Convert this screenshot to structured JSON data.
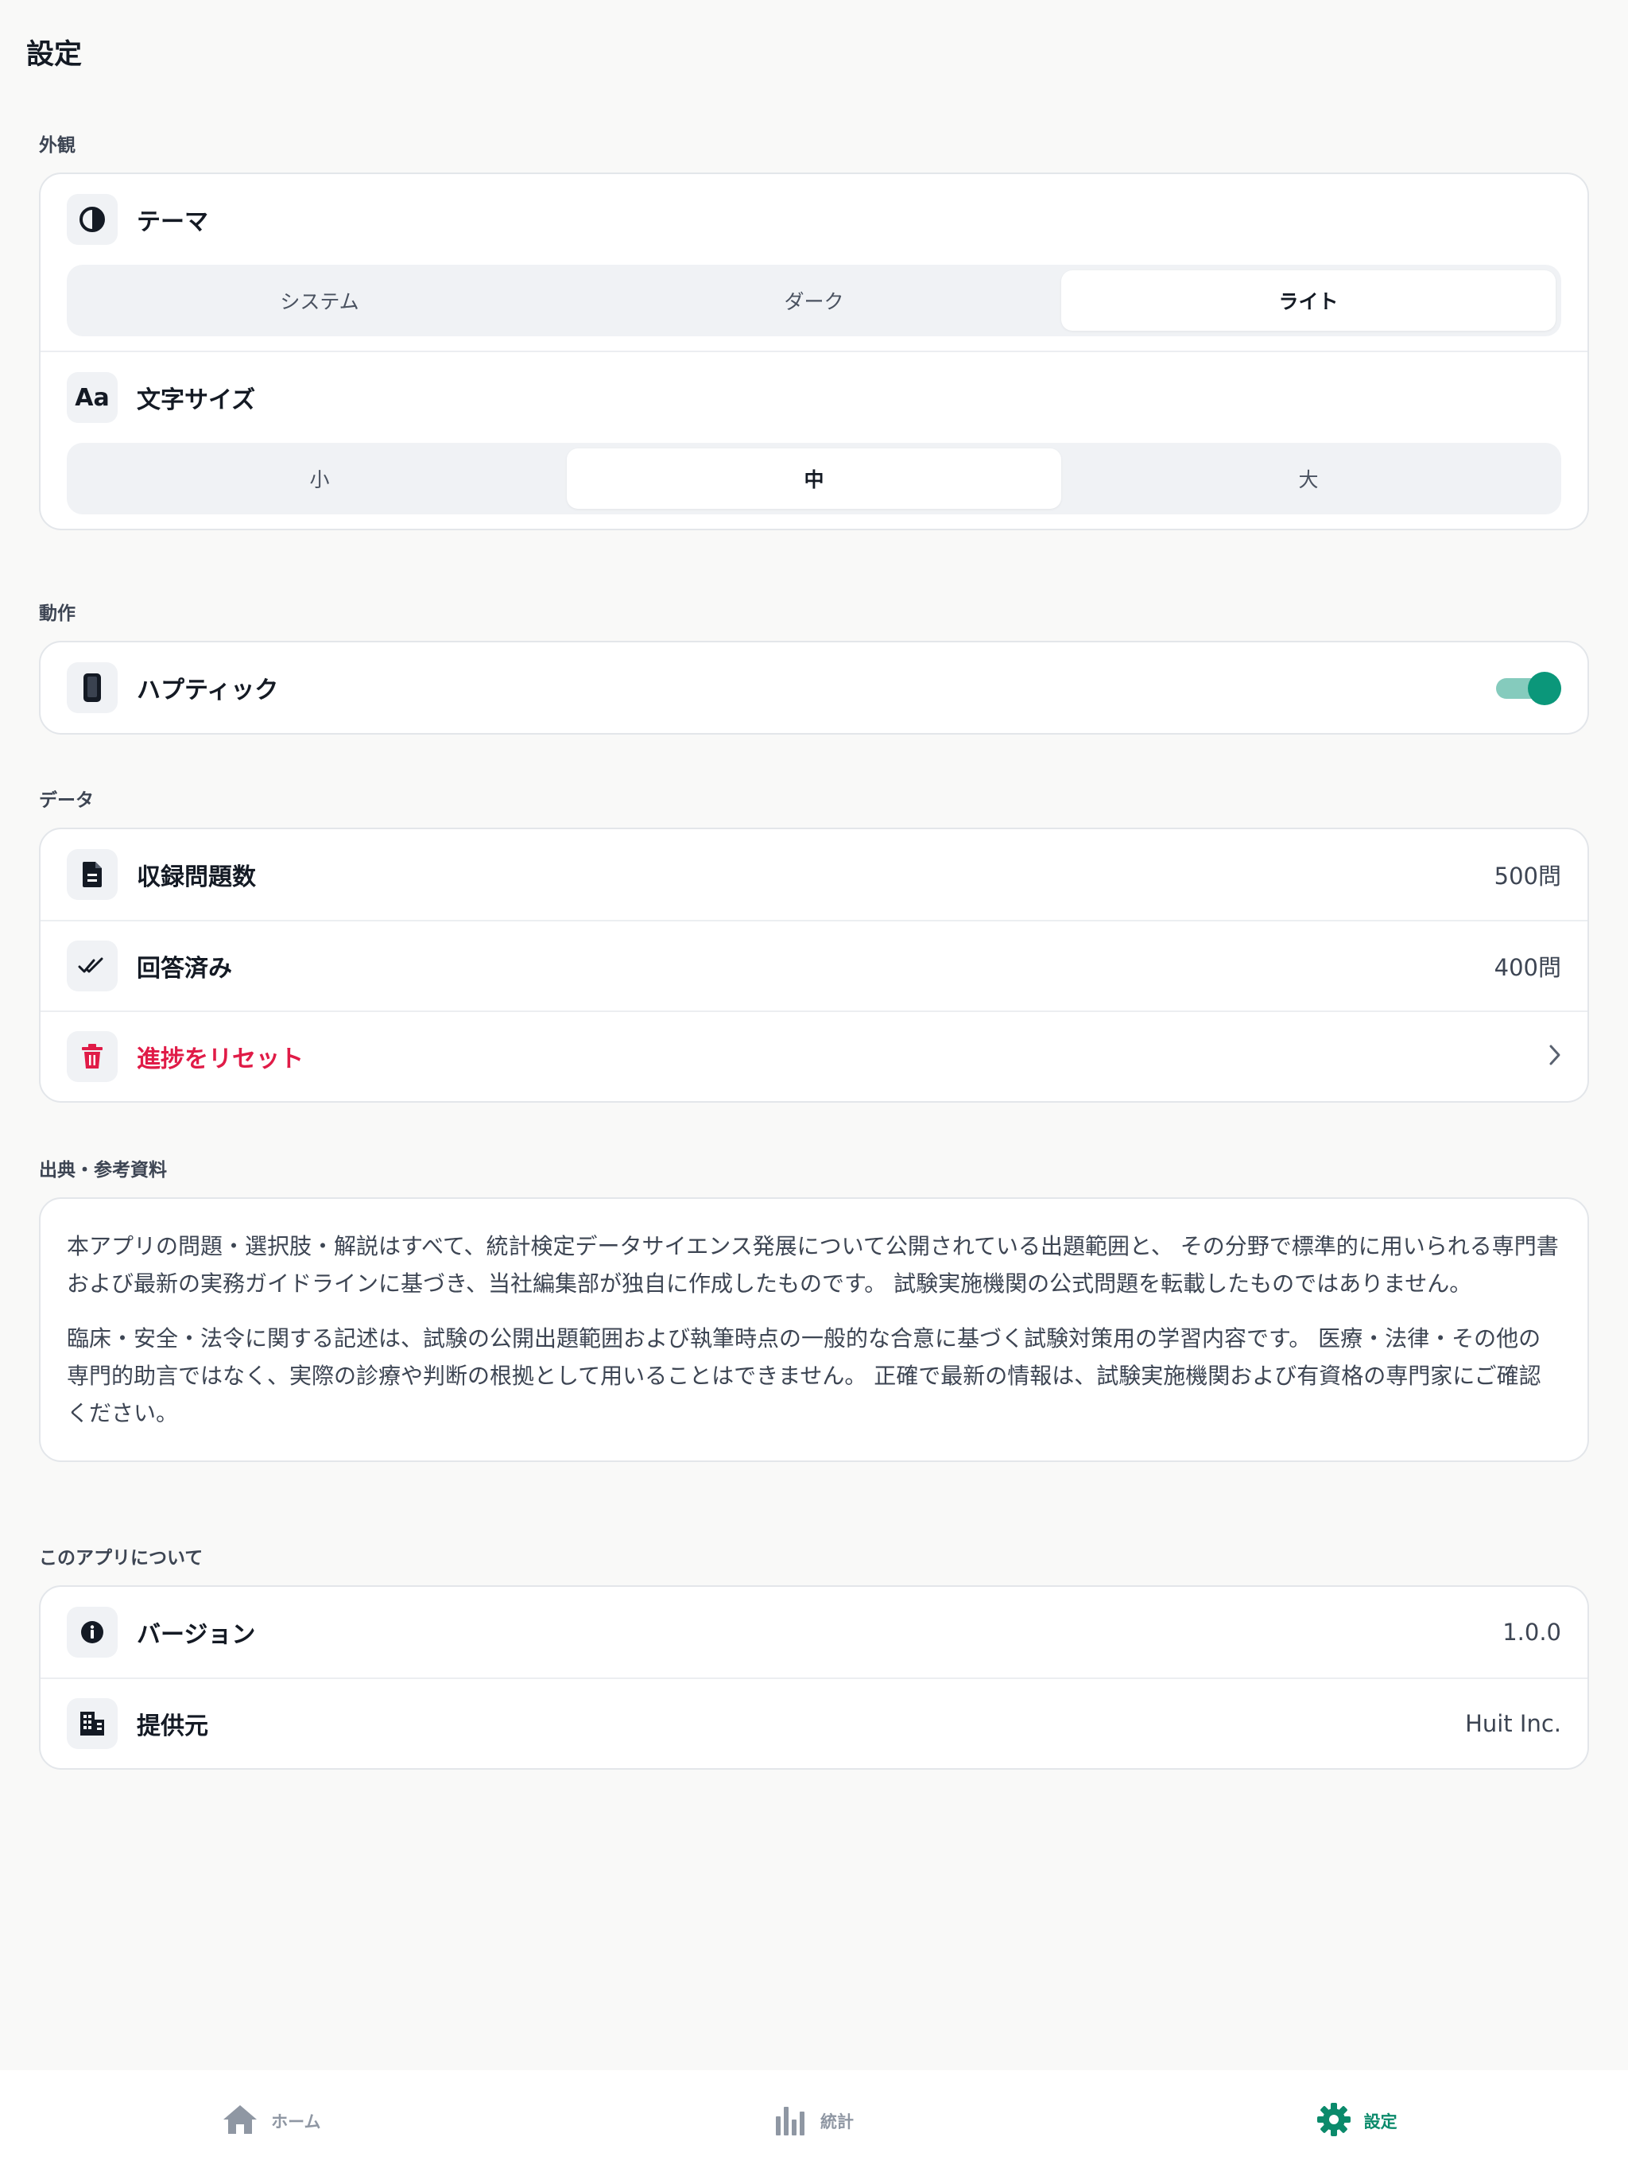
{
  "title": "設定",
  "sections": {
    "appearance": {
      "label": "外観",
      "theme": {
        "label": "テーマ",
        "icon": "contrast-icon",
        "options": [
          "システム",
          "ダーク",
          "ライト"
        ],
        "selected": "ライト"
      },
      "font_size": {
        "label": "文字サイズ",
        "icon": "text-size-icon",
        "icon_text": "Aa",
        "options": [
          "小",
          "中",
          "大"
        ],
        "selected": "中"
      }
    },
    "behavior": {
      "label": "動作",
      "haptic": {
        "label": "ハプティック",
        "icon": "phone-icon",
        "enabled": true
      }
    },
    "data": {
      "label": "データ",
      "total_questions": {
        "label": "収録問題数",
        "value": "500問",
        "icon": "document-icon"
      },
      "answered": {
        "label": "回答済み",
        "value": "400問",
        "icon": "double-check-icon"
      },
      "reset": {
        "label": "進捗をリセット",
        "icon": "trash-icon"
      }
    },
    "sources": {
      "label": "出典・参考資料",
      "paragraphs": [
        "本アプリの問題・選択肢・解説はすべて、統計検定データサイエンス発展について公開されている出題範囲と、 その分野で標準的に用いられる専門書および最新の実務ガイドラインに基づき、当社編集部が独自に作成したものです。 試験実施機関の公式問題を転載したものではありません。",
        "臨床・安全・法令に関する記述は、試験の公開出題範囲および執筆時点の一般的な合意に基づく試験対策用の学習内容です。 医療・法律・その他の専門的助言ではなく、実際の診療や判断の根拠として用いることはできません。 正確で最新の情報は、試験実施機関および有資格の専門家にご確認ください。"
      ]
    },
    "about": {
      "label": "このアプリについて",
      "version": {
        "label": "バージョン",
        "value": "1.0.0",
        "icon": "info-icon"
      },
      "provider": {
        "label": "提供元",
        "value": "Huit Inc.",
        "icon": "building-icon"
      }
    }
  },
  "tabs": [
    {
      "label": "ホーム",
      "icon": "home-icon",
      "active": false
    },
    {
      "label": "統計",
      "icon": "bar-chart-icon",
      "active": false
    },
    {
      "label": "設定",
      "icon": "gear-icon",
      "active": true
    }
  ],
  "colors": {
    "accent": "#0b977a",
    "danger": "#e01b47",
    "background": "#f9f9f8"
  }
}
